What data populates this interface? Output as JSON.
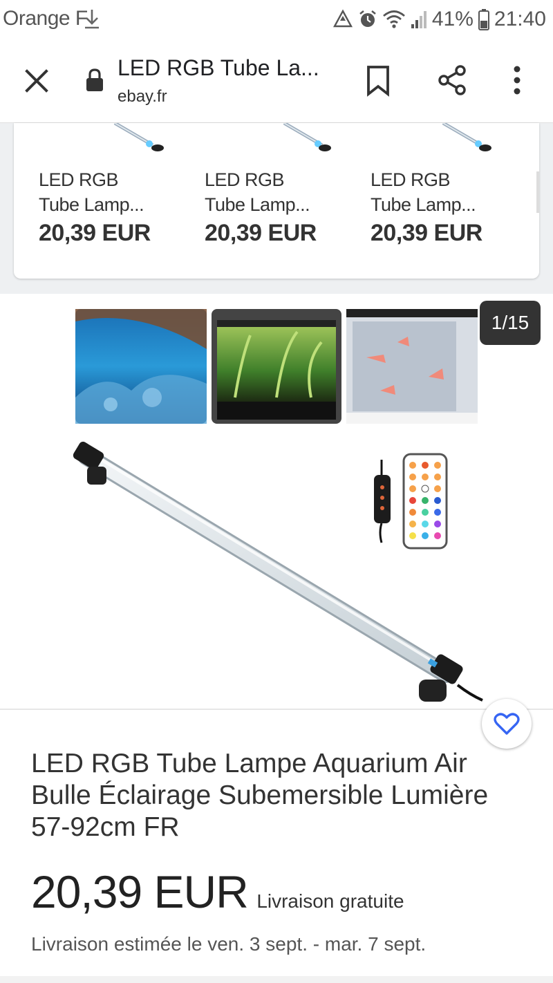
{
  "status_bar": {
    "carrier": "Orange F",
    "battery": "41%",
    "time": "21:40",
    "icons": [
      "download-icon",
      "recycle-icon",
      "alarm-icon",
      "wifi-icon",
      "signal-icon",
      "battery-icon"
    ]
  },
  "toolbar": {
    "title": "LED RGB Tube La...",
    "domain": "ebay.fr",
    "icons": [
      "close-icon",
      "lock-icon",
      "bookmark-icon",
      "share-icon",
      "more-vert-icon"
    ]
  },
  "related": {
    "items": [
      {
        "name_line1": "LED RGB",
        "name_line2": "Tube Lamp...",
        "price": "20,39 EUR"
      },
      {
        "name_line1": "LED RGB",
        "name_line2": "Tube Lamp...",
        "price": "20,39 EUR"
      },
      {
        "name_line1": "LED RGB",
        "name_line2": "Tube Lamp...",
        "price": "20,39 EUR"
      }
    ]
  },
  "gallery": {
    "counter": "1/15"
  },
  "product": {
    "title": "LED RGB Tube Lampe Aquarium Air Bulle Éclairage Subemersible Lumière 57-92cm FR",
    "price": "20,39 EUR",
    "shipping": "Livraison gratuite",
    "delivery": "Livraison estimée le ven. 3 sept. - mar. 7 sept."
  },
  "colors": {
    "accent": "#3665f3",
    "text": "#333333",
    "counter_bg": "#333333"
  }
}
